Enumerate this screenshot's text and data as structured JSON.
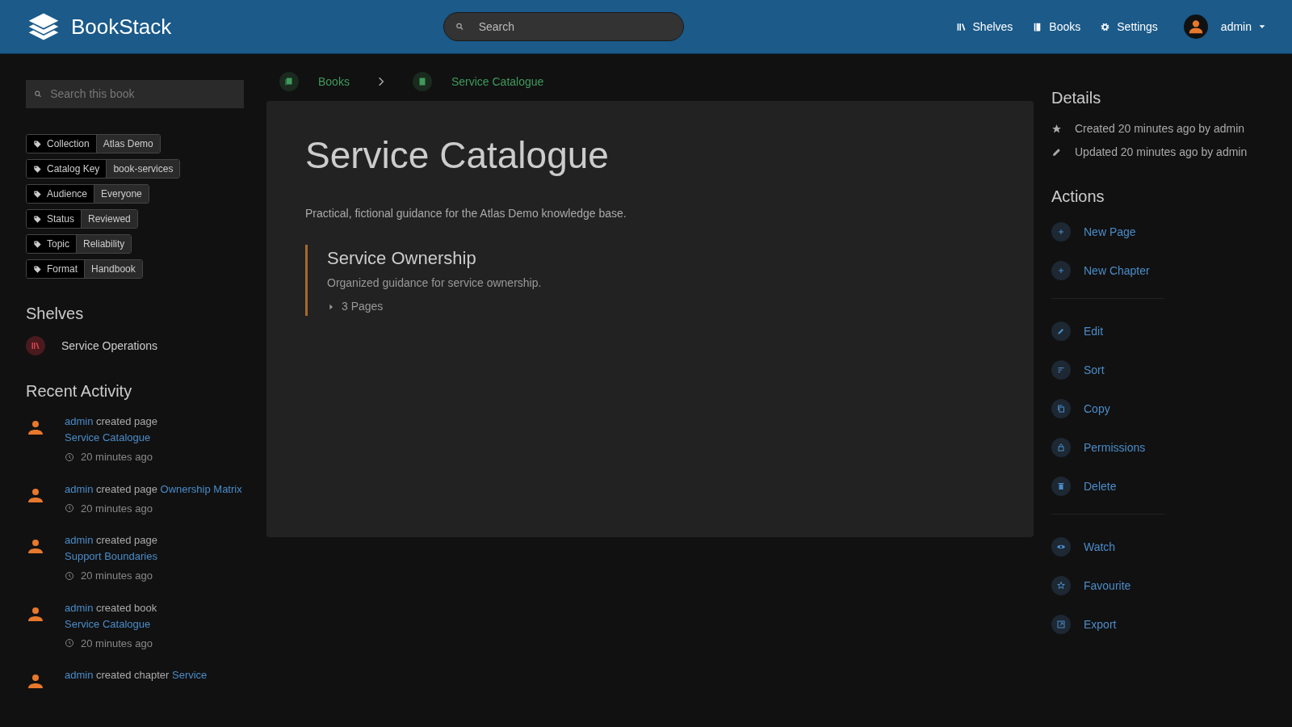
{
  "header": {
    "logo_text": "BookStack",
    "search": {
      "placeholder": "Search"
    },
    "nav": [
      "Shelves",
      "Books",
      "Settings"
    ],
    "user": "admin"
  },
  "sidebar_left": {
    "search": {
      "placeholder": "Search this book"
    },
    "tags": [
      {
        "name": "Collection",
        "value": "Atlas Demo"
      },
      {
        "name": "Catalog Key",
        "value": "book-services"
      },
      {
        "name": "Audience",
        "value": "Everyone"
      },
      {
        "name": "Status",
        "value": "Reviewed"
      },
      {
        "name": "Topic",
        "value": "Reliability"
      },
      {
        "name": "Format",
        "value": "Handbook"
      }
    ],
    "shelves_title": "Shelves",
    "shelves": [
      "Service Operations"
    ],
    "activity_title": "Recent Activity",
    "activity": [
      {
        "user": "admin",
        "action": "created page",
        "target": "Service Catalogue",
        "time": "20 minutes ago"
      },
      {
        "user": "admin",
        "action": "created page",
        "target": "Ownership Matrix",
        "time": "20 minutes ago"
      },
      {
        "user": "admin",
        "action": "created page",
        "target": "Support Boundaries",
        "time": "20 minutes ago"
      },
      {
        "user": "admin",
        "action": "created book",
        "target": "Service Catalogue",
        "time": "20 minutes ago"
      },
      {
        "user": "admin",
        "action": "created chapter",
        "target": "Service"
      }
    ]
  },
  "breadcrumbs": [
    "Books",
    "Service Catalogue"
  ],
  "book": {
    "title": "Service Catalogue",
    "description": "Practical, fictional guidance for the Atlas Demo knowledge base.",
    "chapters": [
      {
        "title": "Service Ownership",
        "description": "Organized guidance for service ownership.",
        "pages": "3 Pages",
        "expanded": false
      }
    ]
  },
  "details": {
    "title": "Details",
    "lines": [
      "Created 20 minutes ago by admin",
      "Updated 20 minutes ago by admin"
    ]
  },
  "actions": {
    "title": "Actions",
    "groups": [
      [
        "New Page",
        "New Chapter"
      ],
      [
        "Edit",
        "Sort",
        "Copy",
        "Permissions",
        "Delete"
      ],
      [
        "Watch",
        "Favourite",
        "Export"
      ]
    ]
  }
}
